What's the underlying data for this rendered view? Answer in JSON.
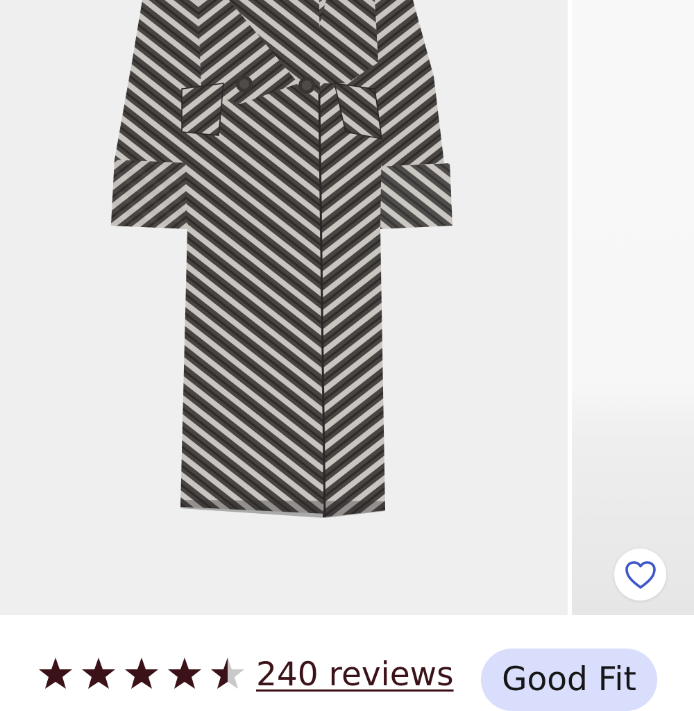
{
  "product_images": {
    "main": {
      "icon": "herringbone-coat-photo",
      "alt": ""
    },
    "next": {
      "icon": "next-product-photo"
    }
  },
  "favorite": {
    "icon": "heart-outline-icon",
    "color": "#3f56c9"
  },
  "rating": {
    "value": 4.5,
    "max": 5,
    "star_color": "#3a1218",
    "empty_color": "#c9c9c9",
    "reviews_label": "240 reviews"
  },
  "fit_badge": {
    "label": "Good Fit",
    "background": "#d8defc"
  }
}
